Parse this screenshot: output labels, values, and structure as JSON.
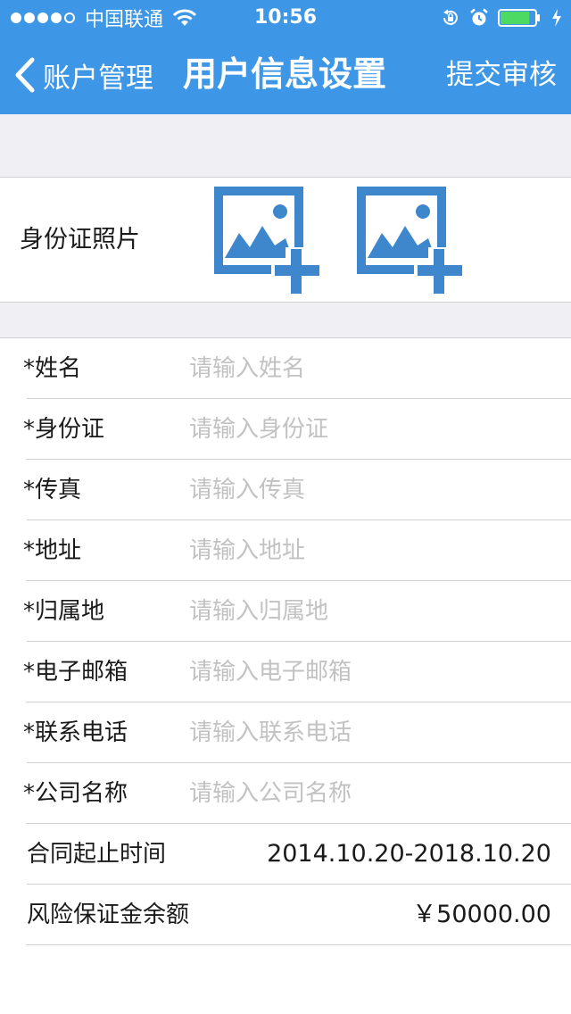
{
  "status_bar": {
    "carrier": "中国联通",
    "time": "10:56",
    "signal_bars_filled": 4,
    "signal_bars_total": 5,
    "battery_level": 0.85
  },
  "nav": {
    "back_label": "账户管理",
    "title": "用户信息设置",
    "submit_label": "提交审核"
  },
  "photo": {
    "label": "身份证照片",
    "slots": [
      "add-photo-icon",
      "add-photo-icon"
    ]
  },
  "form": {
    "fields": [
      {
        "label": "*姓名",
        "placeholder": "请输入姓名",
        "value": ""
      },
      {
        "label": "*身份证",
        "placeholder": "请输入身份证",
        "value": ""
      },
      {
        "label": "*传真",
        "placeholder": "请输入传真",
        "value": ""
      },
      {
        "label": "*地址",
        "placeholder": "请输入地址",
        "value": ""
      },
      {
        "label": "*归属地",
        "placeholder": "请输入归属地",
        "value": ""
      },
      {
        "label": "*电子邮箱",
        "placeholder": "请输入电子邮箱",
        "value": ""
      },
      {
        "label": "*联系电话",
        "placeholder": "请输入联系电话",
        "value": ""
      },
      {
        "label": "*公司名称",
        "placeholder": "请输入公司名称",
        "value": ""
      }
    ],
    "info_rows": [
      {
        "label": "合同起止时间",
        "value": "2014.10.20-2018.10.20"
      },
      {
        "label": "风险保证金余额",
        "value": "￥50000.00"
      }
    ]
  },
  "colors": {
    "header_bg": "#3d97e6",
    "page_gap_bg": "#efeff4",
    "icon_blue": "#3f87cc",
    "battery_green": "#4cd964",
    "placeholder_gray": "#c2c2c2"
  }
}
